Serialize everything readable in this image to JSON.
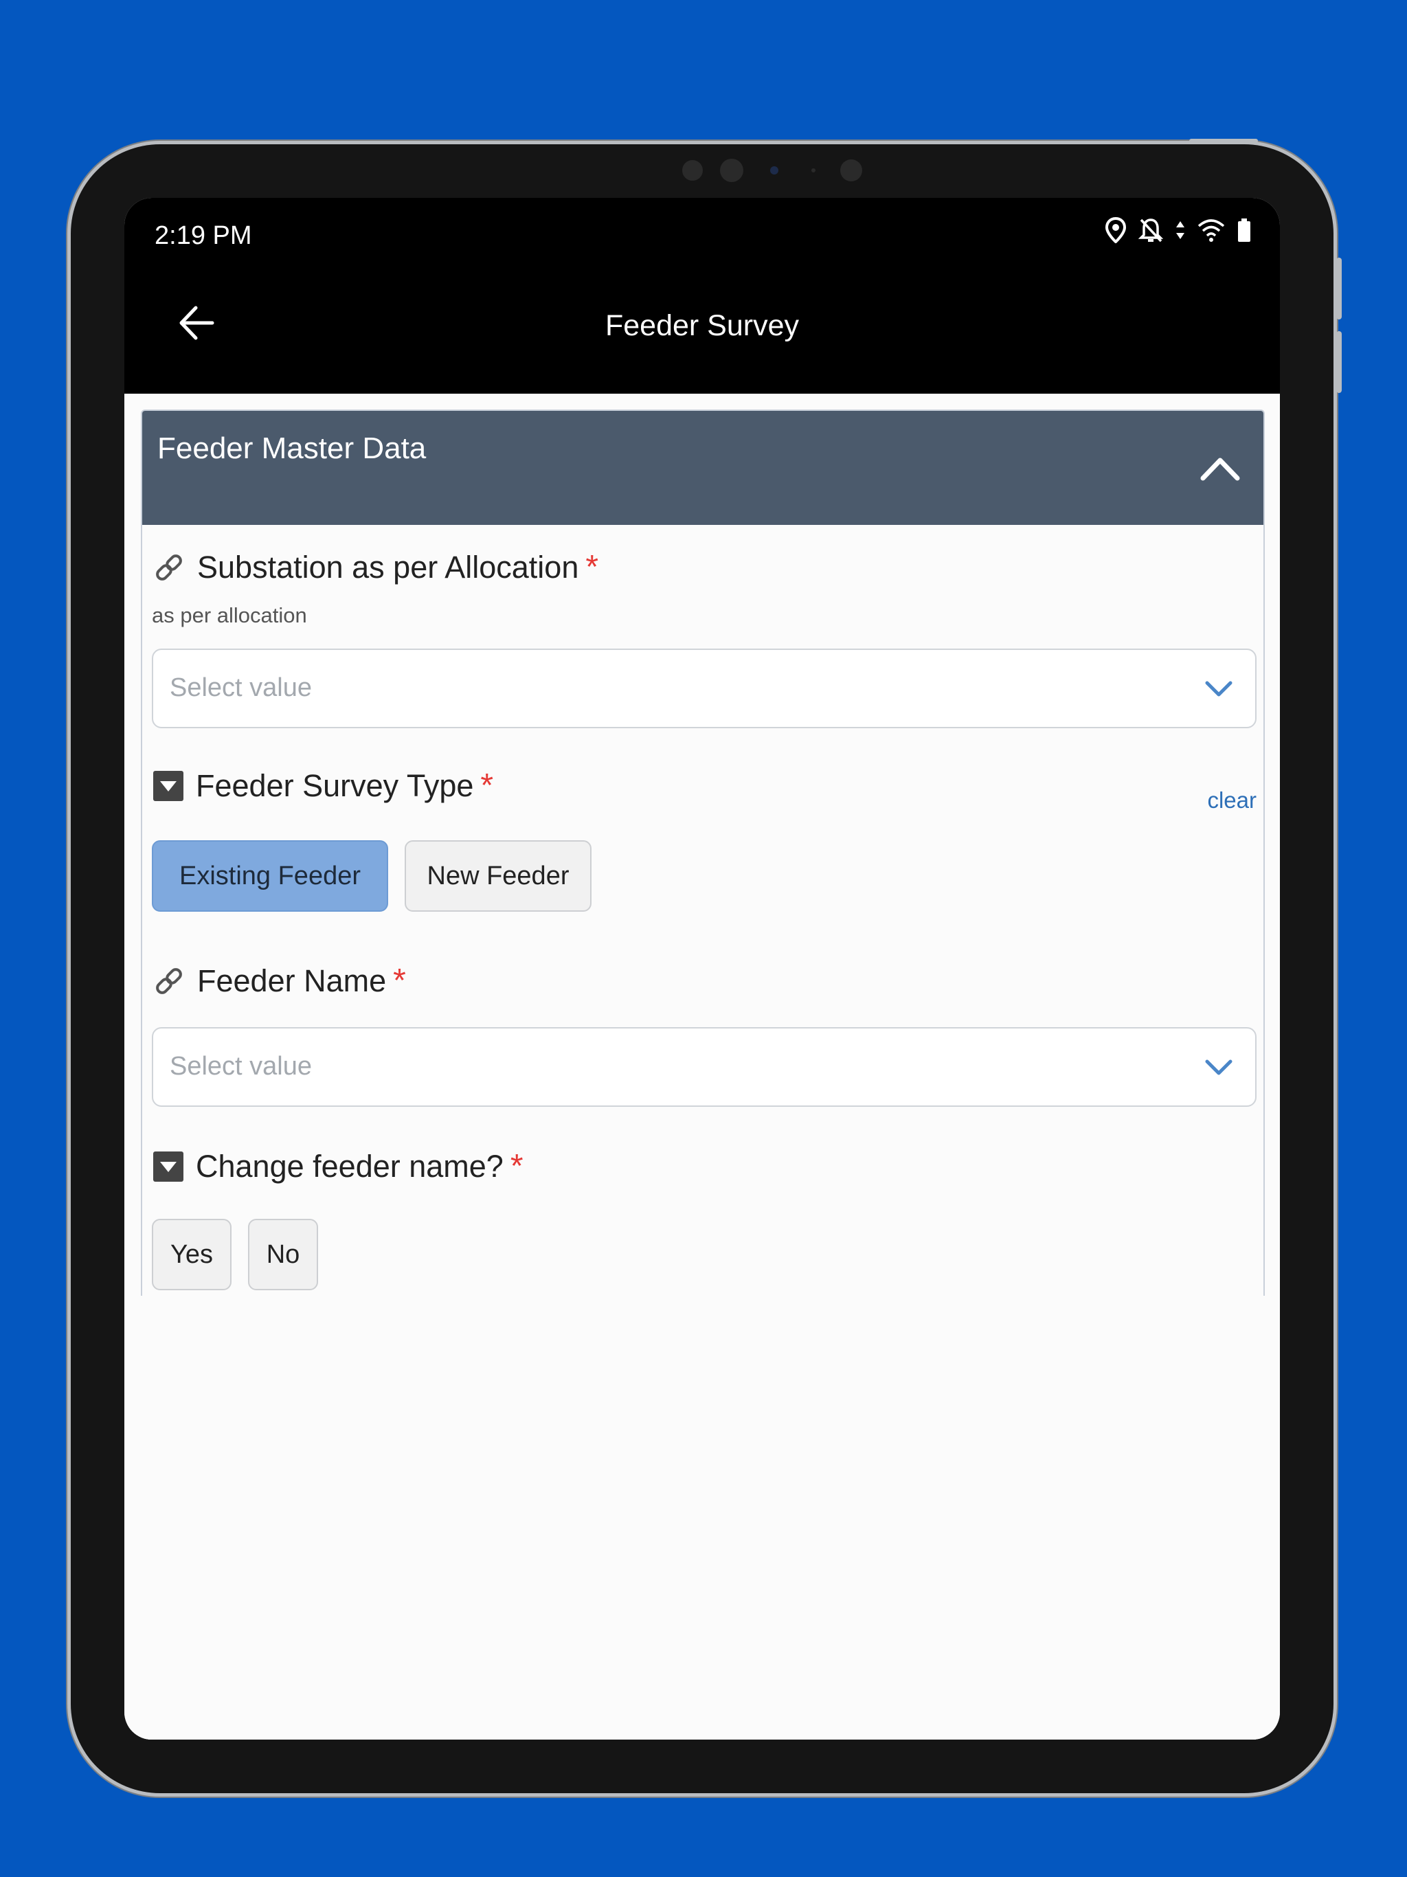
{
  "status_bar": {
    "time": "2:19 PM",
    "icons": [
      "location-icon",
      "notifications-off-icon",
      "data-transfer-icon",
      "wifi-icon",
      "battery-icon"
    ]
  },
  "app_bar": {
    "title": "Feeder Survey",
    "back_icon": "arrow-left-icon"
  },
  "section": {
    "title": "Feeder Master Data",
    "collapse_icon": "chevron-up-icon"
  },
  "fields": {
    "substation": {
      "label": "Substation as per Allocation",
      "required": "*",
      "hint": "as per allocation",
      "placeholder": "Select value"
    },
    "survey_type": {
      "label": "Feeder Survey Type",
      "required": "*",
      "clear": "clear",
      "options": [
        "Existing Feeder",
        "New Feeder"
      ],
      "selected": "Existing Feeder"
    },
    "feeder_name": {
      "label": "Feeder Name",
      "required": "*",
      "placeholder": "Select value"
    },
    "change_name": {
      "label": "Change feeder name?",
      "required": "*",
      "options": [
        "Yes",
        "No"
      ]
    }
  },
  "colors": {
    "background": "#0457bf",
    "section_header": "#4b5a6c",
    "selected_chip": "#7fa9de",
    "required": "#e53935",
    "link": "#2d6fb7"
  }
}
